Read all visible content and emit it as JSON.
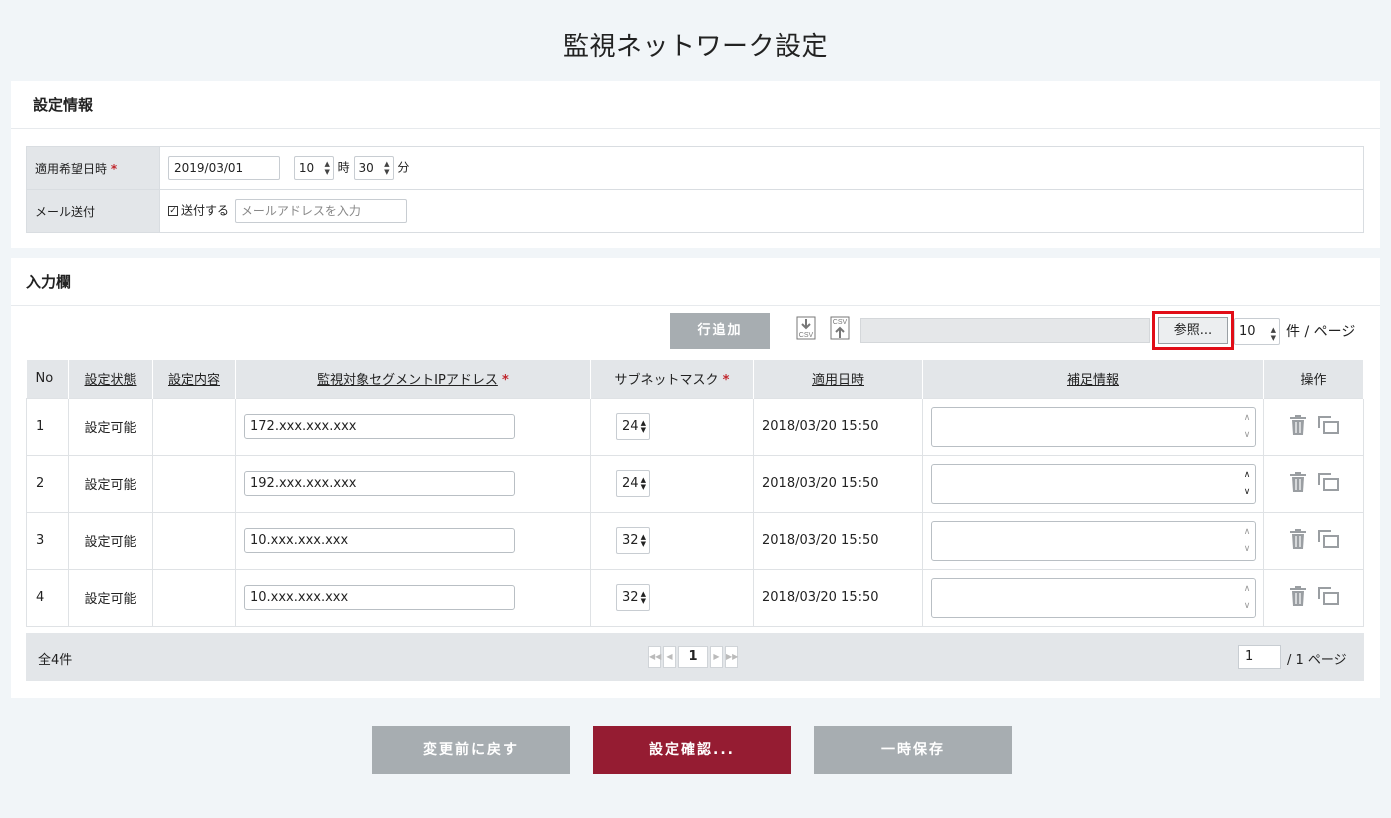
{
  "title": "監視ネットワーク設定",
  "settings": {
    "heading": "設定情報",
    "date_label": "適用希望日時",
    "required_mark": "*",
    "date_value": "2019/03/01",
    "hour_value": "10",
    "hour_unit": "時",
    "minute_value": "30",
    "minute_unit": "分",
    "mail_label": "メール送付",
    "mail_checkbox_label": "送付する",
    "mail_checked": true,
    "mail_placeholder": "メールアドレスを入力"
  },
  "input_panel": {
    "heading": "入力欄",
    "add_row_label": "行追加",
    "csv_icon_text": "CSV",
    "browse_label": "参照...",
    "per_page_value": "10",
    "per_page_unit": "件 / ページ",
    "columns": [
      "No",
      "設定状態",
      "設定内容",
      "監視対象セグメントIPアドレス",
      "サブネットマスク",
      "適用日時",
      "補足情報",
      "操作"
    ],
    "rows": [
      {
        "no": "1",
        "status": "設定可能",
        "content": "",
        "ip": "172.xxx.xxx.xxx",
        "mask": "24",
        "date": "2018/03/20 15:50",
        "note": ""
      },
      {
        "no": "2",
        "status": "設定可能",
        "content": "",
        "ip": "192.xxx.xxx.xxx",
        "mask": "24",
        "date": "2018/03/20 15:50",
        "note": ""
      },
      {
        "no": "3",
        "status": "設定可能",
        "content": "",
        "ip": "10.xxx.xxx.xxx",
        "mask": "32",
        "date": "2018/03/20 15:50",
        "note": ""
      },
      {
        "no": "4",
        "status": "設定可能",
        "content": "",
        "ip": "10.xxx.xxx.xxx",
        "mask": "32",
        "date": "2018/03/20 15:50",
        "note": ""
      }
    ],
    "total_label": "全4件",
    "current_page": "1",
    "page_input_value": "1",
    "page_total_label": "/ 1 ページ"
  },
  "buttons": {
    "revert": "変更前に戻す",
    "confirm": "設定確認...",
    "save_temp": "一時保存"
  },
  "colors": {
    "highlight_border": "#e10d17",
    "confirm_button": "#951c32",
    "gray_button": "#a7adb1",
    "required": "#c1272d"
  }
}
